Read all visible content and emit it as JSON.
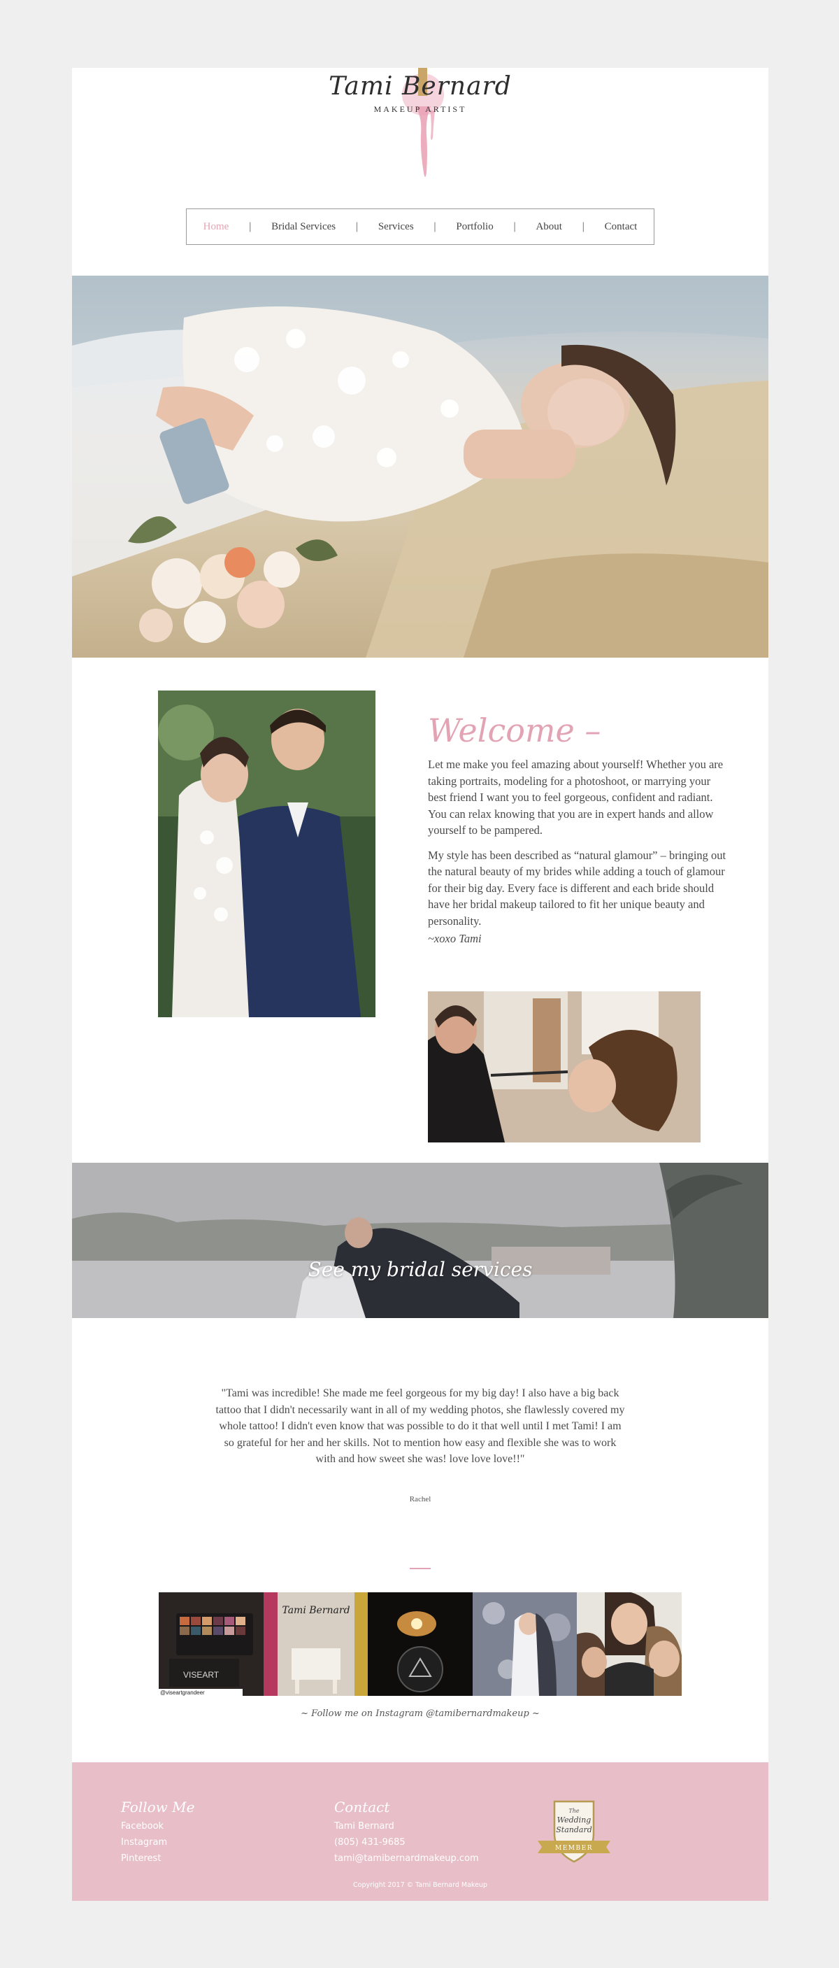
{
  "brand": {
    "name": "Tami Bernard",
    "tagline": "MAKEUP ARTIST",
    "accent": "#e2a4b4"
  },
  "nav": {
    "items": [
      {
        "label": "Home",
        "active": true
      },
      {
        "label": "Bridal Services"
      },
      {
        "label": "Services"
      },
      {
        "label": "Portfolio"
      },
      {
        "label": "About"
      },
      {
        "label": "Contact"
      }
    ],
    "separator": "|"
  },
  "welcome": {
    "title": "Welcome –",
    "paragraph1": "Let me make you feel amazing about yourself! Whether you are taking portraits, modeling for a photoshoot, or marrying your best friend I want you to feel gorgeous, confident and radiant. You can relax knowing that you are in expert hands and allow yourself to be pampered.",
    "paragraph2": "My style has been described as “natural glamour” – bringing out the natural beauty of my brides while adding a touch of glamour for their big day. Every face is different and each bride should have her bridal makeup tailored to fit her unique beauty and personality.",
    "signature": "~xoxo Tami"
  },
  "banner": {
    "label": "See my bridal services"
  },
  "testimonial": {
    "quote": "\"Tami was incredible! She made me feel gorgeous for my big day! I also have a big back tattoo that I didn't necessarily want in all of my wedding photos, she flawlessly covered my whole tattoo! I didn't even know that was possible to do it that well until I met Tami! I am so grateful for her and her skills. Not to mention how easy and flexible she was to work with and how sweet she was! love love love!!\"",
    "author": "Rachel"
  },
  "instagram": {
    "caption": "~ Follow me on Instagram @tamibernardmakeup ~",
    "tile1_text": "VISEART",
    "tile1_handle": "@viseartgrandeer",
    "tile2_text": "Tami Bernard"
  },
  "footer": {
    "follow": {
      "heading": "Follow Me",
      "links": [
        "Facebook",
        "Instagram",
        "Pinterest"
      ]
    },
    "contact": {
      "heading": "Contact",
      "name": "Tami Bernard",
      "phone": "(805) 431-9685",
      "email": "tami@tamibernardmakeup.com"
    },
    "badge": {
      "line1": "The",
      "line2": "Wedding",
      "line3": "Standard",
      "ribbon": "MEMBER"
    },
    "copyright": "Copyright 2017 © Tami Bernard Makeup"
  }
}
